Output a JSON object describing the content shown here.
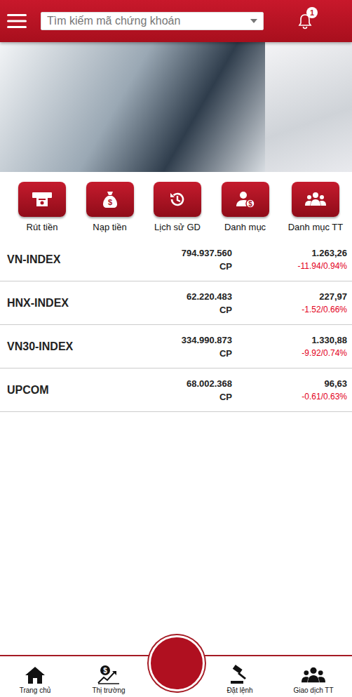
{
  "header": {
    "search": {
      "placeholder": "Tìm kiếm mã chứng khoán"
    },
    "notification": {
      "badge": "1"
    }
  },
  "banner": {
    "slides": [
      {
        "kind": "main"
      },
      {
        "kind": "peek"
      }
    ]
  },
  "actions": [
    {
      "label": "Rút tiền",
      "kind": "withdraw"
    },
    {
      "label": "Nạp tiền",
      "kind": "deposit"
    },
    {
      "label": "Lịch sử GD",
      "kind": "history"
    },
    {
      "label": "Danh mục",
      "kind": "portfolio"
    },
    {
      "label": "Danh mục TT",
      "kind": "group"
    }
  ],
  "indices": [
    {
      "name": "VN-INDEX",
      "volume": "794.937.560",
      "unit": "CP",
      "value": "1.263,26",
      "change": "-11.94/0.94%",
      "trend": "down"
    },
    {
      "name": "HNX-INDEX",
      "volume": "62.220.483",
      "unit": "CP",
      "value": "227,97",
      "change": "-1.52/0.66%",
      "trend": "down"
    },
    {
      "name": "VN30-INDEX",
      "volume": "334.990.873",
      "unit": "CP",
      "value": "1.330,88",
      "change": "-9.92/0.74%",
      "trend": "down"
    },
    {
      "name": "UPCOM",
      "volume": "68.002.368",
      "unit": "CP",
      "value": "96,63",
      "change": "-0.61/0.63%",
      "trend": "down"
    }
  ],
  "bottom_nav": [
    {
      "label": "Trang chủ",
      "kind": "home",
      "selected": false
    },
    {
      "label": "Thị trường",
      "kind": "market",
      "selected": false
    },
    {
      "label": "Đặt lệnh",
      "kind": "order",
      "selected": false
    },
    {
      "label": "Giao dịch TT",
      "kind": "group",
      "selected": false
    }
  ]
}
